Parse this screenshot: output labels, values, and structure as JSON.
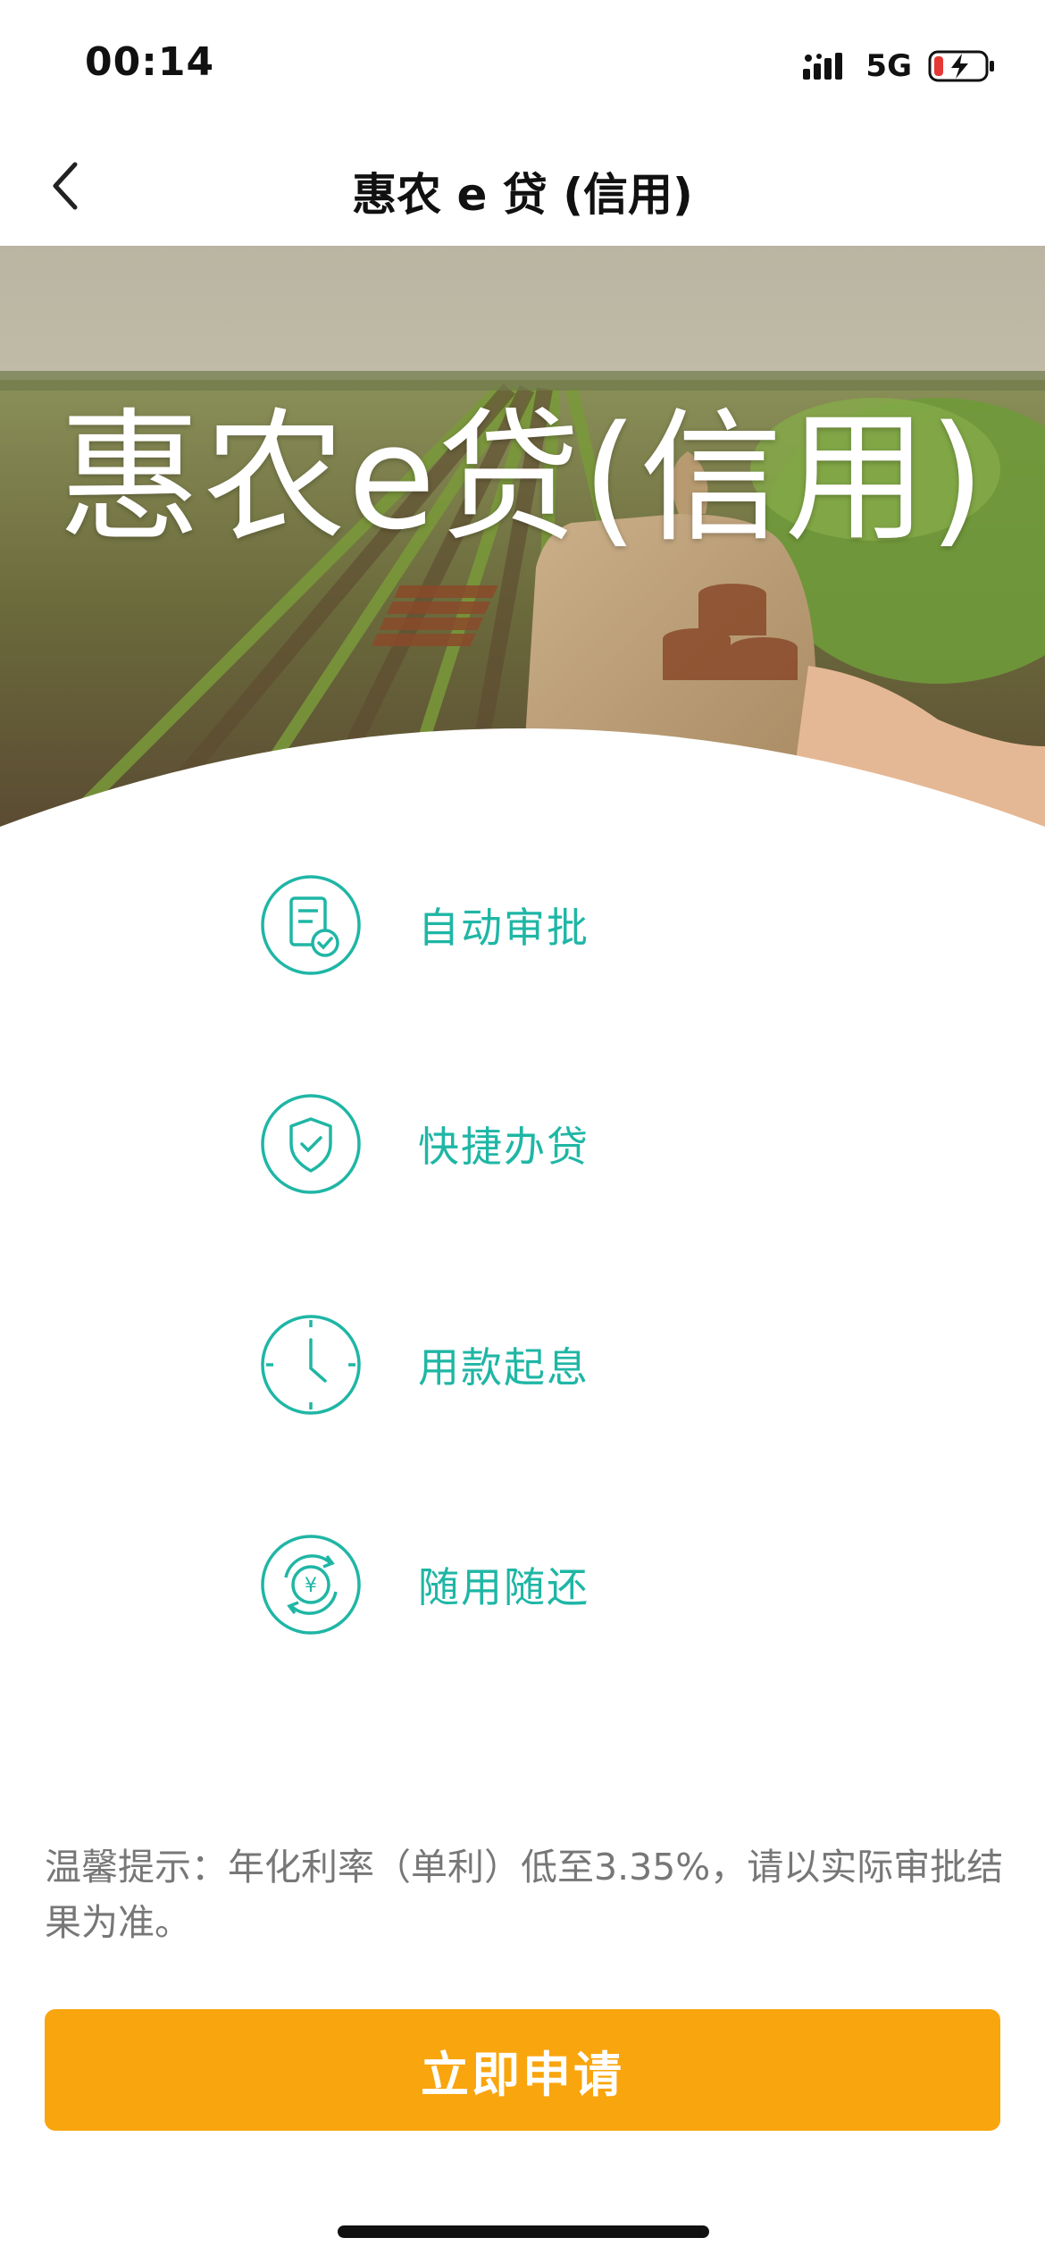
{
  "status_bar": {
    "time": "00:14",
    "network": "5G",
    "icons": [
      "signal-icon",
      "battery-charging-icon"
    ]
  },
  "nav": {
    "title": "惠农 e 贷 (信用)",
    "back_icon": "chevron-left-icon"
  },
  "hero": {
    "title": "惠农e贷(信用)"
  },
  "features": [
    {
      "label": "自动审批",
      "icon": "document-check-icon"
    },
    {
      "label": "快捷办贷",
      "icon": "shield-check-icon"
    },
    {
      "label": "用款起息",
      "icon": "clock-icon"
    },
    {
      "label": "随用随还",
      "icon": "yuan-cycle-icon"
    }
  ],
  "tip": {
    "text": "温馨提示：年化利率（单利）低至3.35%，请以实际审批结果为准。"
  },
  "apply_button": {
    "label": "立即申请"
  },
  "colors": {
    "accent": "#1fb6a5",
    "button": "#f9a50d",
    "tip_text": "#777777"
  }
}
